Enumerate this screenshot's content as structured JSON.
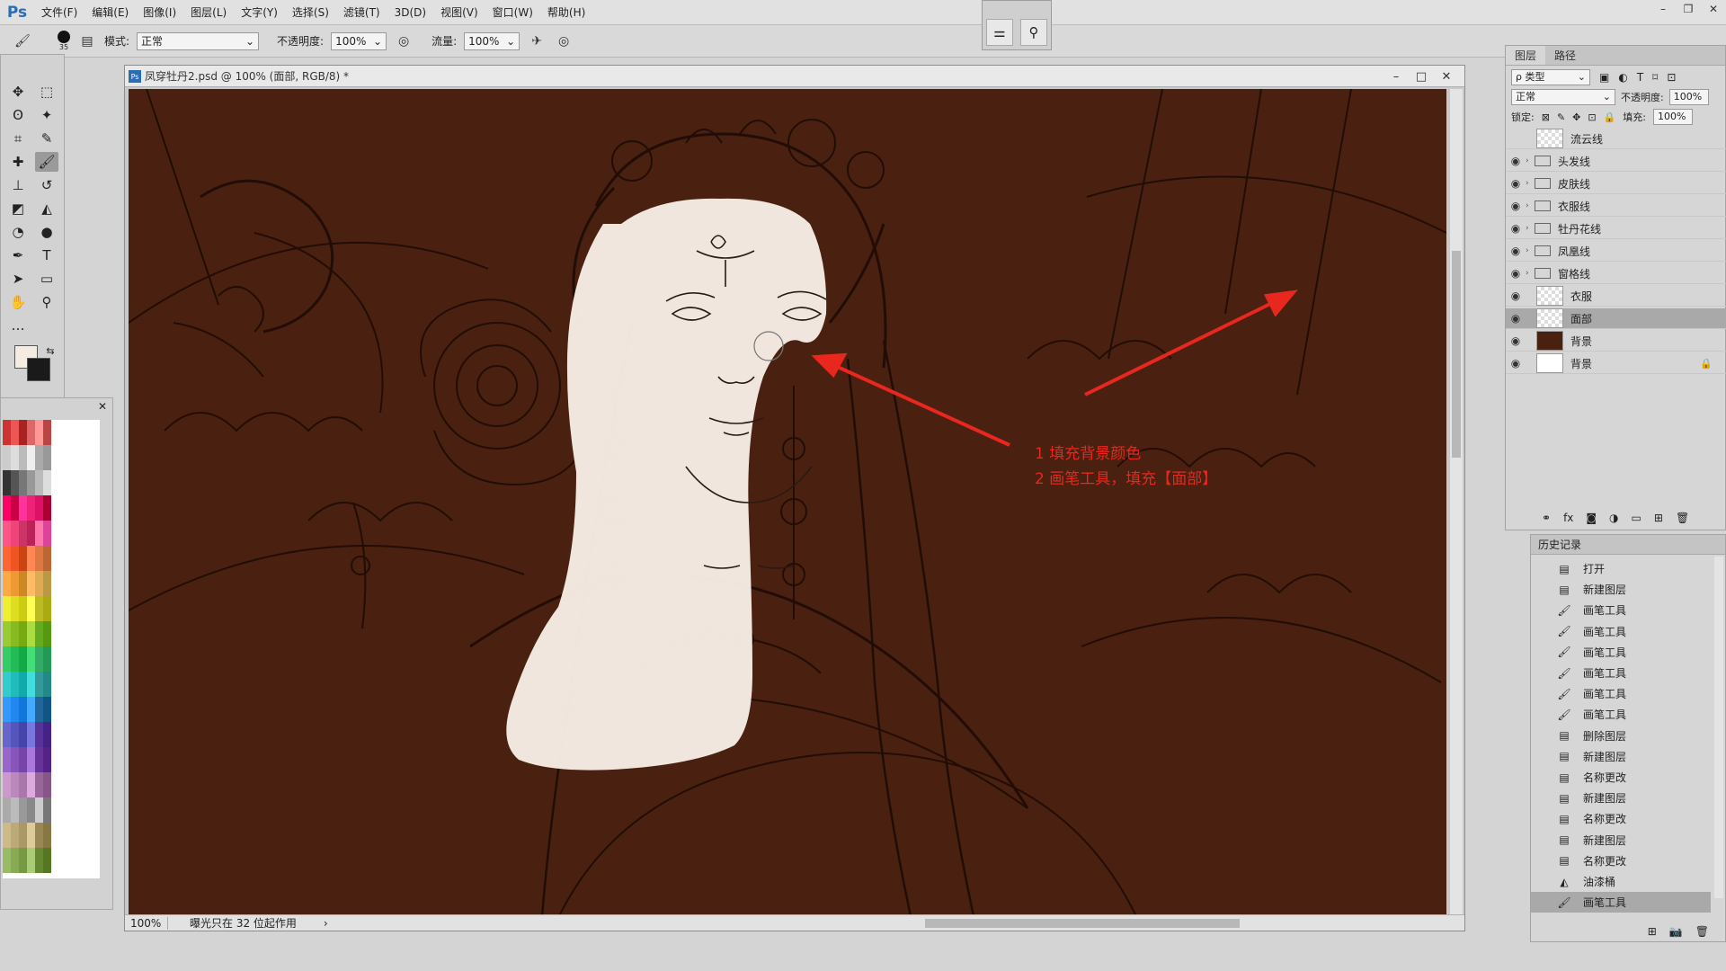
{
  "app": {
    "logo": "Ps"
  },
  "menu": [
    "文件(F)",
    "编辑(E)",
    "图像(I)",
    "图层(L)",
    "文字(Y)",
    "选择(S)",
    "滤镜(T)",
    "3D(D)",
    "视图(V)",
    "窗口(W)",
    "帮助(H)"
  ],
  "options": {
    "mode_label": "模式:",
    "mode_value": "正常",
    "opacity_label": "不透明度:",
    "opacity_value": "100%",
    "flow_label": "流量:",
    "flow_value": "100%",
    "brush_size": "35"
  },
  "document": {
    "title": "凤穿牡丹2.psd @ 100% (面部, RGB/8) *",
    "status_zoom": "100%",
    "status_info": "曝光只在 32 位起作用"
  },
  "annotation": {
    "line1": "1 填充背景颜色",
    "line2": "2 画笔工具，填充【面部】",
    "color": "#e8271e"
  },
  "layers_panel": {
    "tabs": [
      "图层",
      "路径"
    ],
    "filter": "ρ 类型",
    "blend_mode": "正常",
    "opacity_label": "不透明度:",
    "opacity_value": "100%",
    "lock_label": "锁定:",
    "fill_label": "填充:",
    "fill_value": "100%",
    "layers": [
      {
        "name": "流云线",
        "visible": false,
        "type": "layer"
      },
      {
        "name": "头发线",
        "visible": true,
        "type": "group"
      },
      {
        "name": "皮肤线",
        "visible": true,
        "type": "group"
      },
      {
        "name": "衣服线",
        "visible": true,
        "type": "group"
      },
      {
        "name": "牡丹花线",
        "visible": true,
        "type": "group"
      },
      {
        "name": "凤凰线",
        "visible": true,
        "type": "group"
      },
      {
        "name": "窗格线",
        "visible": true,
        "type": "group"
      },
      {
        "name": "衣服",
        "visible": true,
        "type": "layer"
      },
      {
        "name": "面部",
        "visible": true,
        "type": "layer",
        "selected": true
      },
      {
        "name": "背景",
        "visible": true,
        "type": "fill",
        "color": "#4a2010"
      },
      {
        "name": "背景",
        "visible": true,
        "type": "white",
        "locked": true
      }
    ]
  },
  "history_panel": {
    "title": "历史记录",
    "items": [
      {
        "label": "打开",
        "icon": "doc"
      },
      {
        "label": "新建图层",
        "icon": "doc"
      },
      {
        "label": "画笔工具",
        "icon": "brush"
      },
      {
        "label": "画笔工具",
        "icon": "brush"
      },
      {
        "label": "画笔工具",
        "icon": "brush"
      },
      {
        "label": "画笔工具",
        "icon": "brush"
      },
      {
        "label": "画笔工具",
        "icon": "brush"
      },
      {
        "label": "画笔工具",
        "icon": "brush"
      },
      {
        "label": "删除图层",
        "icon": "doc"
      },
      {
        "label": "新建图层",
        "icon": "doc"
      },
      {
        "label": "名称更改",
        "icon": "doc"
      },
      {
        "label": "新建图层",
        "icon": "doc"
      },
      {
        "label": "名称更改",
        "icon": "doc"
      },
      {
        "label": "新建图层",
        "icon": "doc"
      },
      {
        "label": "名称更改",
        "icon": "doc"
      },
      {
        "label": "油漆桶",
        "icon": "bucket"
      },
      {
        "label": "画笔工具",
        "icon": "brush",
        "selected": true
      }
    ]
  },
  "colors": {
    "canvas_bg": "#4a2010",
    "face_fill": "#f6ece4",
    "line": "#1e0c05"
  }
}
